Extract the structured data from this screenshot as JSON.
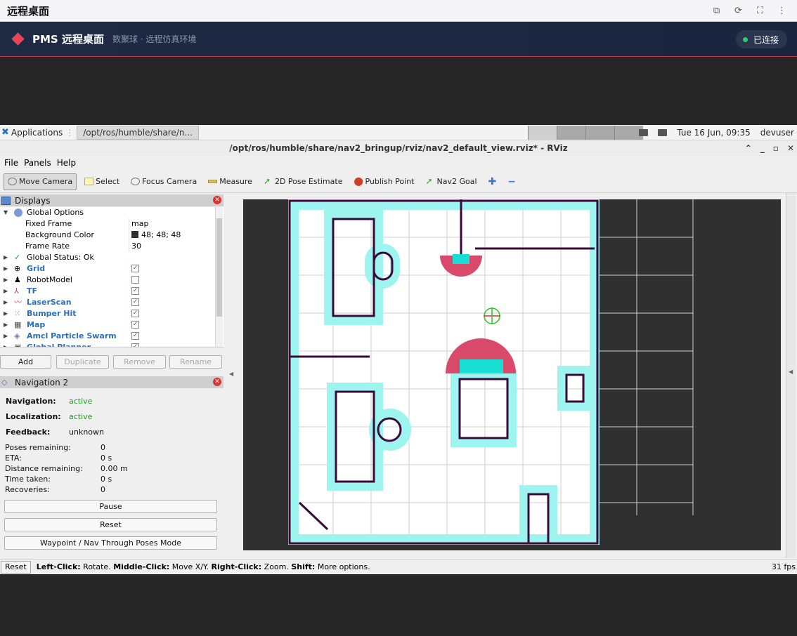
{
  "browser": {
    "title": "远程桌面"
  },
  "pms": {
    "name": "PMS 远程桌面",
    "subtitle": "数聚球 · 远程仿真环境",
    "status": "已连接"
  },
  "taskbar": {
    "apps_label": "Applications",
    "task_label": "/opt/ros/humble/share/n...",
    "clock": "Tue 16 Jun, 09:35",
    "user": "devuser"
  },
  "window": {
    "title": "/opt/ros/humble/share/nav2_bringup/rviz/nav2_default_view.rviz* - RViz"
  },
  "menu": {
    "file": "File",
    "panels": "Panels",
    "help": "Help"
  },
  "toolbar": {
    "move_camera": "Move Camera",
    "select": "Select",
    "focus_camera": "Focus Camera",
    "measure": "Measure",
    "pose_estimate": "2D Pose Estimate",
    "publish_point": "Publish Point",
    "nav2_goal": "Nav2 Goal"
  },
  "displays": {
    "title": "Displays",
    "global_options": "Global Options",
    "fixed_frame_label": "Fixed Frame",
    "fixed_frame_value": "map",
    "bg_color_label": "Background Color",
    "bg_color_value": "48; 48; 48",
    "frame_rate_label": "Frame Rate",
    "frame_rate_value": "30",
    "global_status": "Global Status: Ok",
    "items": [
      "Grid",
      "RobotModel",
      "TF",
      "LaserScan",
      "Bumper Hit",
      "Map",
      "Amcl Particle Swarm",
      "Global Planner"
    ],
    "add": "Add",
    "duplicate": "Duplicate",
    "remove": "Remove",
    "rename": "Rename"
  },
  "nav2": {
    "title": "Navigation 2",
    "navigation_label": "Navigation:",
    "navigation_value": "active",
    "localization_label": "Localization:",
    "localization_value": "active",
    "feedback_label": "Feedback:",
    "feedback_value": "unknown",
    "poses_label": "Poses remaining:",
    "poses_value": "0",
    "eta_label": "ETA:",
    "eta_value": "0 s",
    "distance_label": "Distance remaining:",
    "distance_value": "0.00 m",
    "time_label": "Time taken:",
    "time_value": "0 s",
    "recoveries_label": "Recoveries:",
    "recoveries_value": "0",
    "pause": "Pause",
    "reset": "Reset",
    "waypoint": "Waypoint / Nav Through Poses Mode"
  },
  "status": {
    "reset": "Reset",
    "left": "Left-Click:",
    "left_text": " Rotate. ",
    "middle": "Middle-Click:",
    "middle_text": " Move X/Y. ",
    "right": "Right-Click:",
    "right_text": " Zoom. ",
    "shift": "Shift:",
    "shift_text": " More options.",
    "fps": "31 fps"
  }
}
